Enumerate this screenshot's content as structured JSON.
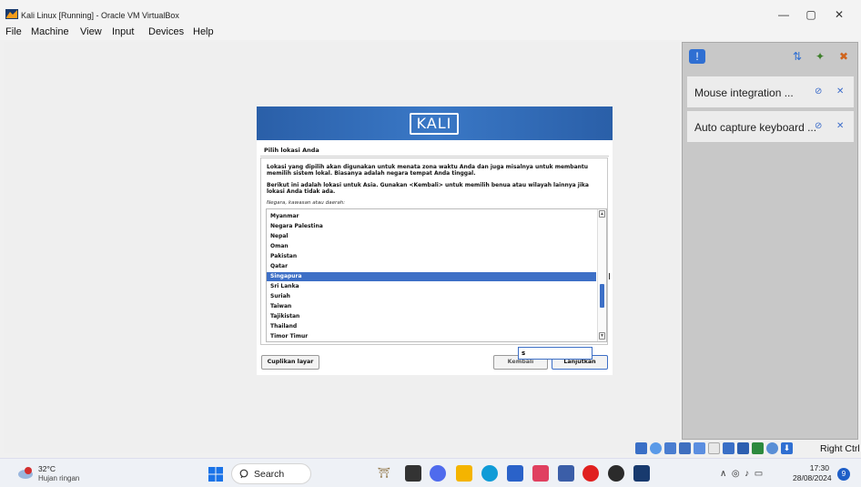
{
  "window": {
    "title": "Kali Linux [Running] - Oracle VM VirtualBox",
    "controls": {
      "minimize": "—",
      "maximize": "▢",
      "close": "✕"
    }
  },
  "menubar": [
    "File",
    "Machine",
    "View",
    "Input",
    "Devices",
    "Help"
  ],
  "installer": {
    "logo": "KALI",
    "section_title": "Pilih lokasi Anda",
    "description_1": "Lokasi yang dipilih akan digunakan untuk menata zona waktu Anda dan juga misalnya untuk membantu memilih sistem lokal. Biasanya adalah negara tempat Anda tinggal.",
    "description_2": "Berikut ini adalah lokasi untuk Asia. Gunakan <Kembali> untuk memilih benua atau wilayah lainnya jika lokasi Anda tidak ada.",
    "hint": "Negara, kawasan atau daerah:",
    "countries": [
      "Myanmar",
      "Negara Palestina",
      "Nepal",
      "Oman",
      "Pakistan",
      "Qatar",
      "Singapura",
      "Sri Lanka",
      "Suriah",
      "Taiwan",
      "Tajikistan",
      "Thailand",
      "Timor Timur"
    ],
    "selected": "Singapura",
    "typeahead_value": "s",
    "screenshot_button": "Cuplikan layar",
    "back_button": "Kembali",
    "continue_button": "Lanjutkan"
  },
  "sidebar": {
    "mouse_integration": "Mouse integration ...",
    "auto_capture": "Auto capture keyboard ..."
  },
  "vm_status": {
    "host_key": "Right Ctrl"
  },
  "taskbar": {
    "temperature": "32°C",
    "weather": "Hujan ringan",
    "search_placeholder": "Search",
    "time": "17:30",
    "date": "28/08/2024",
    "notifications": "9"
  },
  "colors": {
    "selection": "#3d6fc6",
    "banner": "#2a5fa8"
  }
}
